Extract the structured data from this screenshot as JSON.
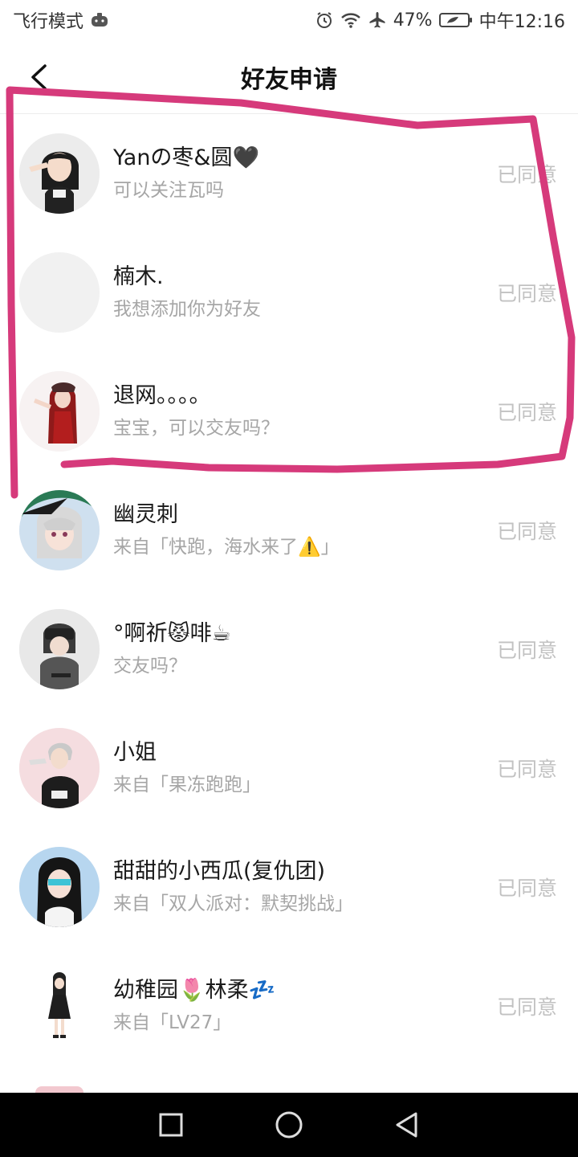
{
  "status_bar": {
    "left_text": "飞行模式",
    "battery": "47%",
    "time": "中午12:16"
  },
  "header": {
    "title": "好友申请"
  },
  "requests": [
    {
      "name": "Yanの枣&圆🖤",
      "message": "可以关注瓦吗",
      "status": "已同意",
      "avatar_icon": "avatar-girl-salute"
    },
    {
      "name": "楠木.",
      "message": "我想添加你为好友",
      "status": "已同意",
      "avatar_icon": "avatar-empty"
    },
    {
      "name": "退网。。。。",
      "message": "宝宝，可以交友吗？",
      "status": "已同意",
      "avatar_icon": "avatar-red-hair"
    },
    {
      "name": "幽灵刺",
      "message": "来自「快跑，海水来了⚠️」",
      "status": "已同意",
      "avatar_icon": "avatar-white-hair"
    },
    {
      "name": "°啊祈😾啡☕",
      "message": "交友吗？",
      "status": "已同意",
      "avatar_icon": "avatar-gray-hood"
    },
    {
      "name": "小姐",
      "message": "来自「果冻跑跑」",
      "status": "已同意",
      "avatar_icon": "avatar-silver-boy"
    },
    {
      "name": "甜甜的小西瓜(复仇团)",
      "message": "来自「双人派对：默契挑战」",
      "status": "已同意",
      "avatar_icon": "avatar-black-hair"
    },
    {
      "name": "幼稚园🌷林柔💤",
      "message": "来自「LV27」",
      "status": "已同意",
      "avatar_icon": "avatar-small-girl"
    }
  ],
  "colors": {
    "annotation": "#d63a7b",
    "status_text": "#c2c2c2",
    "message_text": "#a6a6a6"
  }
}
